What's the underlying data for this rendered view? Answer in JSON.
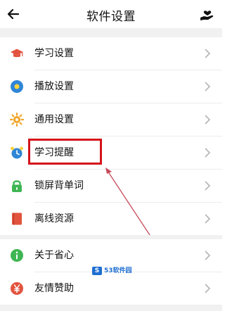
{
  "header": {
    "title": "软件设置",
    "back_icon": "arrow-left-icon",
    "right_icon": "hand-heart-icon"
  },
  "settings": {
    "items": [
      {
        "label": "学习设置",
        "icon": "graduation-cap-icon",
        "icon_color": "#e2533e"
      },
      {
        "label": "播放设置",
        "icon": "play-circle-icon",
        "icon_color": "#2f86d6"
      },
      {
        "label": "通用设置",
        "icon": "sun-gear-icon",
        "icon_color": "#f0a629"
      },
      {
        "label": "学习提醒",
        "icon": "alarm-clock-icon",
        "icon_color": "#2f86d6"
      },
      {
        "label": "锁屏背单词",
        "icon": "lock-icon",
        "icon_color": "#3fb653"
      },
      {
        "label": "离线资源",
        "icon": "book-icon",
        "icon_color": "#e2533e"
      }
    ],
    "items2": [
      {
        "label": "关于省心",
        "icon": "info-circle-icon",
        "icon_color": "#3fb653"
      },
      {
        "label": "友情赞助",
        "icon": "yen-coin-icon",
        "icon_color": "#e2533e"
      }
    ]
  },
  "annotation": {
    "highlight_color": "#d4121a",
    "arrow_color": "#c64a5a"
  },
  "watermark": {
    "text": "53软件园",
    "logo_text": "S"
  }
}
